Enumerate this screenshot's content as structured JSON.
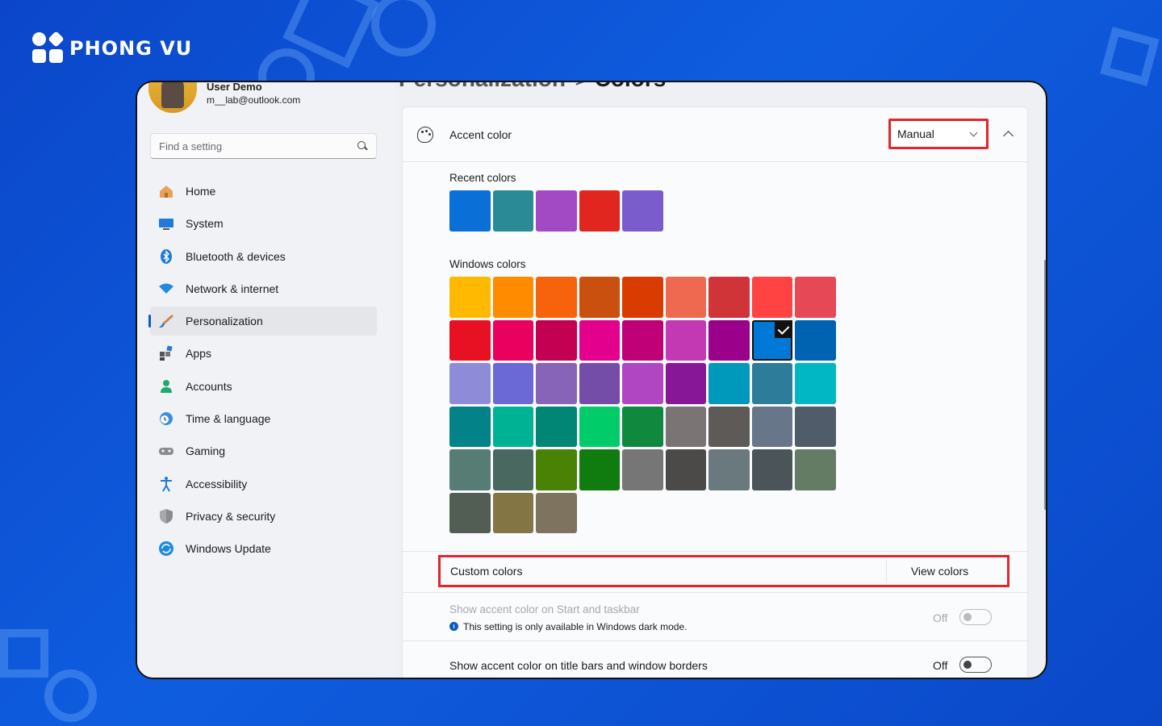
{
  "brand": {
    "name": "PHONG VU"
  },
  "user": {
    "name": "User Demo",
    "email": "m__lab@outlook.com"
  },
  "search": {
    "placeholder": "Find a setting"
  },
  "nav": [
    {
      "label": "Home",
      "icon": "home-icon"
    },
    {
      "label": "System",
      "icon": "monitor-icon"
    },
    {
      "label": "Bluetooth & devices",
      "icon": "bluetooth-icon"
    },
    {
      "label": "Network & internet",
      "icon": "wifi-icon"
    },
    {
      "label": "Personalization",
      "icon": "paintbrush-icon",
      "active": true
    },
    {
      "label": "Apps",
      "icon": "apps-icon"
    },
    {
      "label": "Accounts",
      "icon": "person-icon"
    },
    {
      "label": "Time & language",
      "icon": "clock-globe-icon"
    },
    {
      "label": "Gaming",
      "icon": "gamepad-icon"
    },
    {
      "label": "Accessibility",
      "icon": "accessibility-icon"
    },
    {
      "label": "Privacy & security",
      "icon": "shield-icon"
    },
    {
      "label": "Windows Update",
      "icon": "update-icon"
    }
  ],
  "breadcrumb": {
    "parent": "Personalization",
    "separator": ">",
    "current": "Colors"
  },
  "accent": {
    "title": "Accent color",
    "mode": "Manual",
    "recent_label": "Recent colors",
    "recent": [
      "#0a6fd6",
      "#2a8a95",
      "#a24ac4",
      "#e0261f",
      "#7a5ccd"
    ],
    "windows_label": "Windows colors",
    "windows": [
      [
        "#ffb900",
        "#ff8c00",
        "#f7630c",
        "#ca5010",
        "#da3b01",
        "#ef6950",
        "#d13438",
        "#ff4343",
        "#e74856"
      ],
      [
        "#e81123",
        "#ea005e",
        "#c30052",
        "#e3008c",
        "#bf0077",
        "#c239b3",
        "#9a0089",
        "#0078d7",
        "#0063b1"
      ],
      [
        "#8e8cd8",
        "#6b69d6",
        "#8764b8",
        "#744da9",
        "#b146c2",
        "#881798",
        "#0099bc",
        "#2d7d9a",
        "#00b7c3"
      ],
      [
        "#038387",
        "#00b294",
        "#018574",
        "#00cc6a",
        "#10893e",
        "#7a7574",
        "#5d5a58",
        "#68768a",
        "#515c6b"
      ],
      [
        "#567c73",
        "#486860",
        "#498205",
        "#107c10",
        "#767676",
        "#4c4a48",
        "#69797e",
        "#4a5459",
        "#647c64"
      ],
      [
        "#525e54",
        "#847545",
        "#7e735f"
      ]
    ],
    "selected": {
      "row": 1,
      "col": 7
    }
  },
  "custom": {
    "label": "Custom colors",
    "button": "View colors"
  },
  "start_taskbar": {
    "label": "Show accent color on Start and taskbar",
    "note": "This setting is only available in Windows dark mode.",
    "state": "Off"
  },
  "title_bars": {
    "label": "Show accent color on title bars and window borders",
    "state": "Off"
  },
  "colors": {
    "highlight": "#e0262f",
    "accent": "#0a5bc4",
    "background": "#0b46c9"
  }
}
